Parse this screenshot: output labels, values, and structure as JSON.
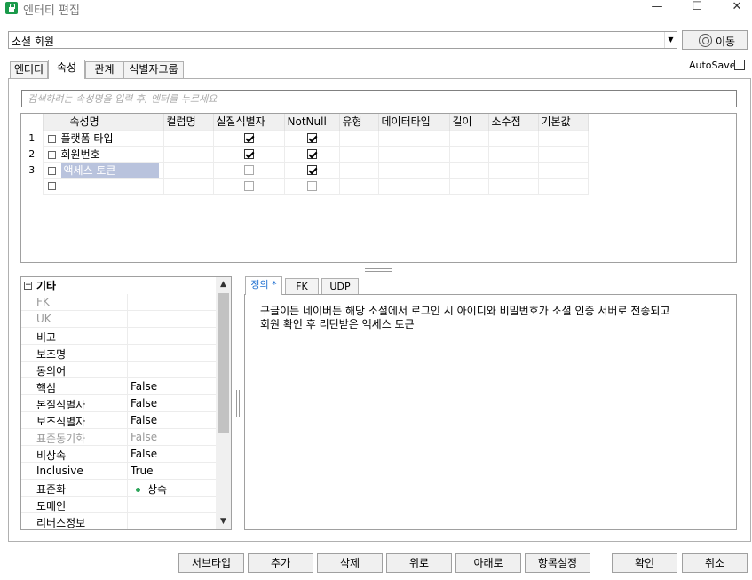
{
  "window": {
    "title": "엔터티 편집",
    "minimize_glyph": "—",
    "maximize_glyph": "☐",
    "close_glyph": "✕"
  },
  "entity_selector": {
    "value": "소셜 회원",
    "move_label": "이동"
  },
  "tabs": [
    {
      "label": "엔터티",
      "active": false
    },
    {
      "label": "속성",
      "active": true
    },
    {
      "label": "관계",
      "active": false
    },
    {
      "label": "식별자그룹",
      "active": false
    }
  ],
  "autosave": {
    "label": "AutoSave",
    "checked": false
  },
  "search": {
    "placeholder": "검색하려는 속성명을 입력 후, 엔터를 누르세요"
  },
  "grid": {
    "headers": [
      "속성명",
      "컬럼명",
      "실질식별자",
      "NotNull",
      "유형",
      "데이터타입",
      "길이",
      "소수점",
      "기본값"
    ],
    "rows": [
      {
        "num": "1",
        "name": "플랫폼 타입",
        "pk": true,
        "notnull": true
      },
      {
        "num": "2",
        "name": "회원번호",
        "pk": true,
        "notnull": true
      },
      {
        "num": "3",
        "name": "액세스 토큰",
        "pk": false,
        "notnull": true,
        "editing": true
      },
      {
        "num": "",
        "name": "",
        "pk": false,
        "notnull": false
      }
    ]
  },
  "properties": {
    "group": "기타",
    "rows": [
      {
        "key": "FK",
        "value": "",
        "dim": true
      },
      {
        "key": "UK",
        "value": "",
        "dim": true
      },
      {
        "key": "비고",
        "value": "",
        "dim": false
      },
      {
        "key": "보조명",
        "value": "",
        "dim": false
      },
      {
        "key": "동의어",
        "value": "",
        "dim": false
      },
      {
        "key": "핵심",
        "value": "False",
        "dim": false
      },
      {
        "key": "본질식별자",
        "value": "False",
        "dim": false
      },
      {
        "key": "보조식별자",
        "value": "False",
        "dim": false
      },
      {
        "key": "표준동기화",
        "value": "False",
        "dim": true
      },
      {
        "key": "비상속",
        "value": "False",
        "dim": false
      },
      {
        "key": "Inclusive",
        "value": "True",
        "dim": false
      },
      {
        "key": "표준화",
        "value": "상속",
        "dim": false,
        "dot": true
      },
      {
        "key": "도메인",
        "value": "",
        "dim": false
      },
      {
        "key": "리버스정보",
        "value": "",
        "dim": false
      }
    ]
  },
  "detail_tabs": [
    {
      "label": "정의 *",
      "active": true
    },
    {
      "label": "FK",
      "active": false
    },
    {
      "label": "UDP",
      "active": false
    }
  ],
  "definition": "구글이든 네이버든 해당 소셜에서 로그인 시 아이디와 비밀번호가 소셜 인증 서버로 전송되고\n회원 확인 후 리턴받은 액세스 토큰",
  "buttons": {
    "subtype": "서브타입",
    "add": "추가",
    "delete": "삭제",
    "up": "위로",
    "down": "아래로",
    "item_settings": "항목설정",
    "ok": "확인",
    "cancel": "취소"
  }
}
